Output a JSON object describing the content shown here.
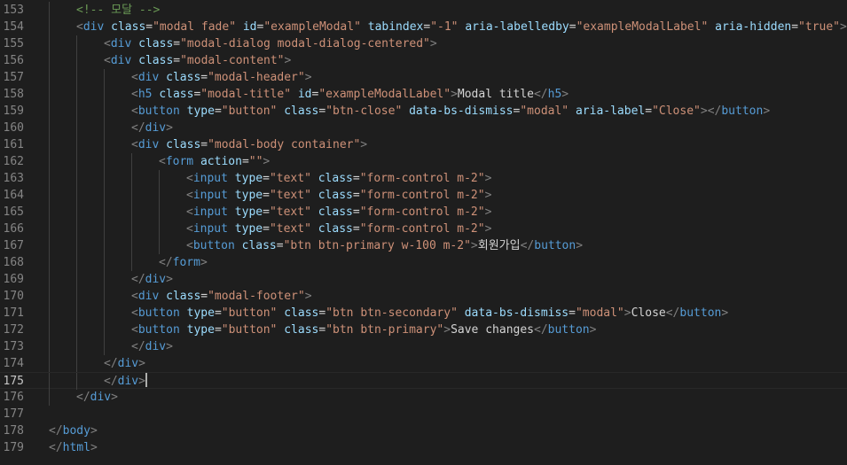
{
  "editor": {
    "current_line": 175,
    "colors": {
      "background": "#1e1e1e",
      "line_number": "#858585",
      "line_number_active": "#c6c6c6",
      "tag_bracket": "#808080",
      "tag_name": "#569cd6",
      "attribute": "#9cdcfe",
      "equals": "#d4d4d4",
      "string": "#ce9178",
      "text": "#d4d4d4",
      "comment": "#6a9955"
    },
    "lines": [
      {
        "num": 153,
        "indent": 1,
        "tokens": [
          [
            "c",
            "<!-- 모달 -->"
          ]
        ]
      },
      {
        "num": 154,
        "indent": 1,
        "tokens": [
          [
            "p",
            "<"
          ],
          [
            "t",
            "div"
          ],
          [
            "x",
            " "
          ],
          [
            "a",
            "class"
          ],
          [
            "e",
            "="
          ],
          [
            "s",
            "\"modal fade\""
          ],
          [
            "x",
            " "
          ],
          [
            "a",
            "id"
          ],
          [
            "e",
            "="
          ],
          [
            "s",
            "\"exampleModal\""
          ],
          [
            "x",
            " "
          ],
          [
            "a",
            "tabindex"
          ],
          [
            "e",
            "="
          ],
          [
            "s",
            "\"-1\""
          ],
          [
            "x",
            " "
          ],
          [
            "a",
            "aria-labelledby"
          ],
          [
            "e",
            "="
          ],
          [
            "s",
            "\"exampleModalLabel\""
          ],
          [
            "x",
            " "
          ],
          [
            "a",
            "aria-hidden"
          ],
          [
            "e",
            "="
          ],
          [
            "s",
            "\"true\""
          ],
          [
            "p",
            ">"
          ]
        ]
      },
      {
        "num": 155,
        "indent": 2,
        "tokens": [
          [
            "p",
            "<"
          ],
          [
            "t",
            "div"
          ],
          [
            "x",
            " "
          ],
          [
            "a",
            "class"
          ],
          [
            "e",
            "="
          ],
          [
            "s",
            "\"modal-dialog modal-dialog-centered\""
          ],
          [
            "p",
            ">"
          ]
        ]
      },
      {
        "num": 156,
        "indent": 2,
        "tokens": [
          [
            "p",
            "<"
          ],
          [
            "t",
            "div"
          ],
          [
            "x",
            " "
          ],
          [
            "a",
            "class"
          ],
          [
            "e",
            "="
          ],
          [
            "s",
            "\"modal-content\""
          ],
          [
            "p",
            ">"
          ]
        ]
      },
      {
        "num": 157,
        "indent": 3,
        "tokens": [
          [
            "p",
            "<"
          ],
          [
            "t",
            "div"
          ],
          [
            "x",
            " "
          ],
          [
            "a",
            "class"
          ],
          [
            "e",
            "="
          ],
          [
            "s",
            "\"modal-header\""
          ],
          [
            "p",
            ">"
          ]
        ]
      },
      {
        "num": 158,
        "indent": 3,
        "tokens": [
          [
            "p",
            "<"
          ],
          [
            "t",
            "h5"
          ],
          [
            "x",
            " "
          ],
          [
            "a",
            "class"
          ],
          [
            "e",
            "="
          ],
          [
            "s",
            "\"modal-title\""
          ],
          [
            "x",
            " "
          ],
          [
            "a",
            "id"
          ],
          [
            "e",
            "="
          ],
          [
            "s",
            "\"exampleModalLabel\""
          ],
          [
            "p",
            ">"
          ],
          [
            "x",
            "Modal title"
          ],
          [
            "p",
            "</"
          ],
          [
            "t",
            "h5"
          ],
          [
            "p",
            ">"
          ]
        ]
      },
      {
        "num": 159,
        "indent": 3,
        "tokens": [
          [
            "p",
            "<"
          ],
          [
            "t",
            "button"
          ],
          [
            "x",
            " "
          ],
          [
            "a",
            "type"
          ],
          [
            "e",
            "="
          ],
          [
            "s",
            "\"button\""
          ],
          [
            "x",
            " "
          ],
          [
            "a",
            "class"
          ],
          [
            "e",
            "="
          ],
          [
            "s",
            "\"btn-close\""
          ],
          [
            "x",
            " "
          ],
          [
            "a",
            "data-bs-dismiss"
          ],
          [
            "e",
            "="
          ],
          [
            "s",
            "\"modal\""
          ],
          [
            "x",
            " "
          ],
          [
            "a",
            "aria-label"
          ],
          [
            "e",
            "="
          ],
          [
            "s",
            "\"Close\""
          ],
          [
            "p",
            "></"
          ],
          [
            "t",
            "button"
          ],
          [
            "p",
            ">"
          ]
        ]
      },
      {
        "num": 160,
        "indent": 3,
        "tokens": [
          [
            "p",
            "</"
          ],
          [
            "t",
            "div"
          ],
          [
            "p",
            ">"
          ]
        ]
      },
      {
        "num": 161,
        "indent": 3,
        "tokens": [
          [
            "p",
            "<"
          ],
          [
            "t",
            "div"
          ],
          [
            "x",
            " "
          ],
          [
            "a",
            "class"
          ],
          [
            "e",
            "="
          ],
          [
            "s",
            "\"modal-body container\""
          ],
          [
            "p",
            ">"
          ]
        ]
      },
      {
        "num": 162,
        "indent": 4,
        "tokens": [
          [
            "p",
            "<"
          ],
          [
            "t",
            "form"
          ],
          [
            "x",
            " "
          ],
          [
            "a",
            "action"
          ],
          [
            "e",
            "="
          ],
          [
            "s",
            "\"\""
          ],
          [
            "p",
            ">"
          ]
        ]
      },
      {
        "num": 163,
        "indent": 5,
        "tokens": [
          [
            "p",
            "<"
          ],
          [
            "t",
            "input"
          ],
          [
            "x",
            " "
          ],
          [
            "a",
            "type"
          ],
          [
            "e",
            "="
          ],
          [
            "s",
            "\"text\""
          ],
          [
            "x",
            " "
          ],
          [
            "a",
            "class"
          ],
          [
            "e",
            "="
          ],
          [
            "s",
            "\"form-control m-2\""
          ],
          [
            "p",
            ">"
          ]
        ]
      },
      {
        "num": 164,
        "indent": 5,
        "tokens": [
          [
            "p",
            "<"
          ],
          [
            "t",
            "input"
          ],
          [
            "x",
            " "
          ],
          [
            "a",
            "type"
          ],
          [
            "e",
            "="
          ],
          [
            "s",
            "\"text\""
          ],
          [
            "x",
            " "
          ],
          [
            "a",
            "class"
          ],
          [
            "e",
            "="
          ],
          [
            "s",
            "\"form-control m-2\""
          ],
          [
            "p",
            ">"
          ]
        ]
      },
      {
        "num": 165,
        "indent": 5,
        "tokens": [
          [
            "p",
            "<"
          ],
          [
            "t",
            "input"
          ],
          [
            "x",
            " "
          ],
          [
            "a",
            "type"
          ],
          [
            "e",
            "="
          ],
          [
            "s",
            "\"text\""
          ],
          [
            "x",
            " "
          ],
          [
            "a",
            "class"
          ],
          [
            "e",
            "="
          ],
          [
            "s",
            "\"form-control m-2\""
          ],
          [
            "p",
            ">"
          ]
        ]
      },
      {
        "num": 166,
        "indent": 5,
        "tokens": [
          [
            "p",
            "<"
          ],
          [
            "t",
            "input"
          ],
          [
            "x",
            " "
          ],
          [
            "a",
            "type"
          ],
          [
            "e",
            "="
          ],
          [
            "s",
            "\"text\""
          ],
          [
            "x",
            " "
          ],
          [
            "a",
            "class"
          ],
          [
            "e",
            "="
          ],
          [
            "s",
            "\"form-control m-2\""
          ],
          [
            "p",
            ">"
          ]
        ]
      },
      {
        "num": 167,
        "indent": 5,
        "tokens": [
          [
            "p",
            "<"
          ],
          [
            "t",
            "button"
          ],
          [
            "x",
            " "
          ],
          [
            "a",
            "class"
          ],
          [
            "e",
            "="
          ],
          [
            "s",
            "\"btn btn-primary w-100 m-2\""
          ],
          [
            "p",
            ">"
          ],
          [
            "x",
            "회원가입"
          ],
          [
            "p",
            "</"
          ],
          [
            "t",
            "button"
          ],
          [
            "p",
            ">"
          ]
        ]
      },
      {
        "num": 168,
        "indent": 4,
        "tokens": [
          [
            "p",
            "</"
          ],
          [
            "t",
            "form"
          ],
          [
            "p",
            ">"
          ]
        ]
      },
      {
        "num": 169,
        "indent": 3,
        "tokens": [
          [
            "p",
            "</"
          ],
          [
            "t",
            "div"
          ],
          [
            "p",
            ">"
          ]
        ]
      },
      {
        "num": 170,
        "indent": 3,
        "tokens": [
          [
            "p",
            "<"
          ],
          [
            "t",
            "div"
          ],
          [
            "x",
            " "
          ],
          [
            "a",
            "class"
          ],
          [
            "e",
            "="
          ],
          [
            "s",
            "\"modal-footer\""
          ],
          [
            "p",
            ">"
          ]
        ]
      },
      {
        "num": 171,
        "indent": 3,
        "tokens": [
          [
            "p",
            "<"
          ],
          [
            "t",
            "button"
          ],
          [
            "x",
            " "
          ],
          [
            "a",
            "type"
          ],
          [
            "e",
            "="
          ],
          [
            "s",
            "\"button\""
          ],
          [
            "x",
            " "
          ],
          [
            "a",
            "class"
          ],
          [
            "e",
            "="
          ],
          [
            "s",
            "\"btn btn-secondary\""
          ],
          [
            "x",
            " "
          ],
          [
            "a",
            "data-bs-dismiss"
          ],
          [
            "e",
            "="
          ],
          [
            "s",
            "\"modal\""
          ],
          [
            "p",
            ">"
          ],
          [
            "x",
            "Close"
          ],
          [
            "p",
            "</"
          ],
          [
            "t",
            "button"
          ],
          [
            "p",
            ">"
          ]
        ]
      },
      {
        "num": 172,
        "indent": 3,
        "tokens": [
          [
            "p",
            "<"
          ],
          [
            "t",
            "button"
          ],
          [
            "x",
            " "
          ],
          [
            "a",
            "type"
          ],
          [
            "e",
            "="
          ],
          [
            "s",
            "\"button\""
          ],
          [
            "x",
            " "
          ],
          [
            "a",
            "class"
          ],
          [
            "e",
            "="
          ],
          [
            "s",
            "\"btn btn-primary\""
          ],
          [
            "p",
            ">"
          ],
          [
            "x",
            "Save changes"
          ],
          [
            "p",
            "</"
          ],
          [
            "t",
            "button"
          ],
          [
            "p",
            ">"
          ]
        ]
      },
      {
        "num": 173,
        "indent": 3,
        "tokens": [
          [
            "p",
            "</"
          ],
          [
            "t",
            "div"
          ],
          [
            "p",
            ">"
          ]
        ]
      },
      {
        "num": 174,
        "indent": 2,
        "tokens": [
          [
            "p",
            "</"
          ],
          [
            "t",
            "div"
          ],
          [
            "p",
            ">"
          ]
        ]
      },
      {
        "num": 175,
        "indent": 2,
        "tokens": [
          [
            "p",
            "</"
          ],
          [
            "t",
            "div"
          ],
          [
            "p",
            ">"
          ]
        ]
      },
      {
        "num": 176,
        "indent": 1,
        "tokens": [
          [
            "p",
            "</"
          ],
          [
            "t",
            "div"
          ],
          [
            "p",
            ">"
          ]
        ]
      },
      {
        "num": 177,
        "indent": 0,
        "tokens": []
      },
      {
        "num": 178,
        "indent": 0,
        "tokens": [
          [
            "p",
            "</"
          ],
          [
            "t",
            "body"
          ],
          [
            "p",
            ">"
          ]
        ]
      },
      {
        "num": 179,
        "indent": 0,
        "tokens": [
          [
            "p",
            "</"
          ],
          [
            "t",
            "html"
          ],
          [
            "p",
            ">"
          ]
        ]
      }
    ]
  }
}
